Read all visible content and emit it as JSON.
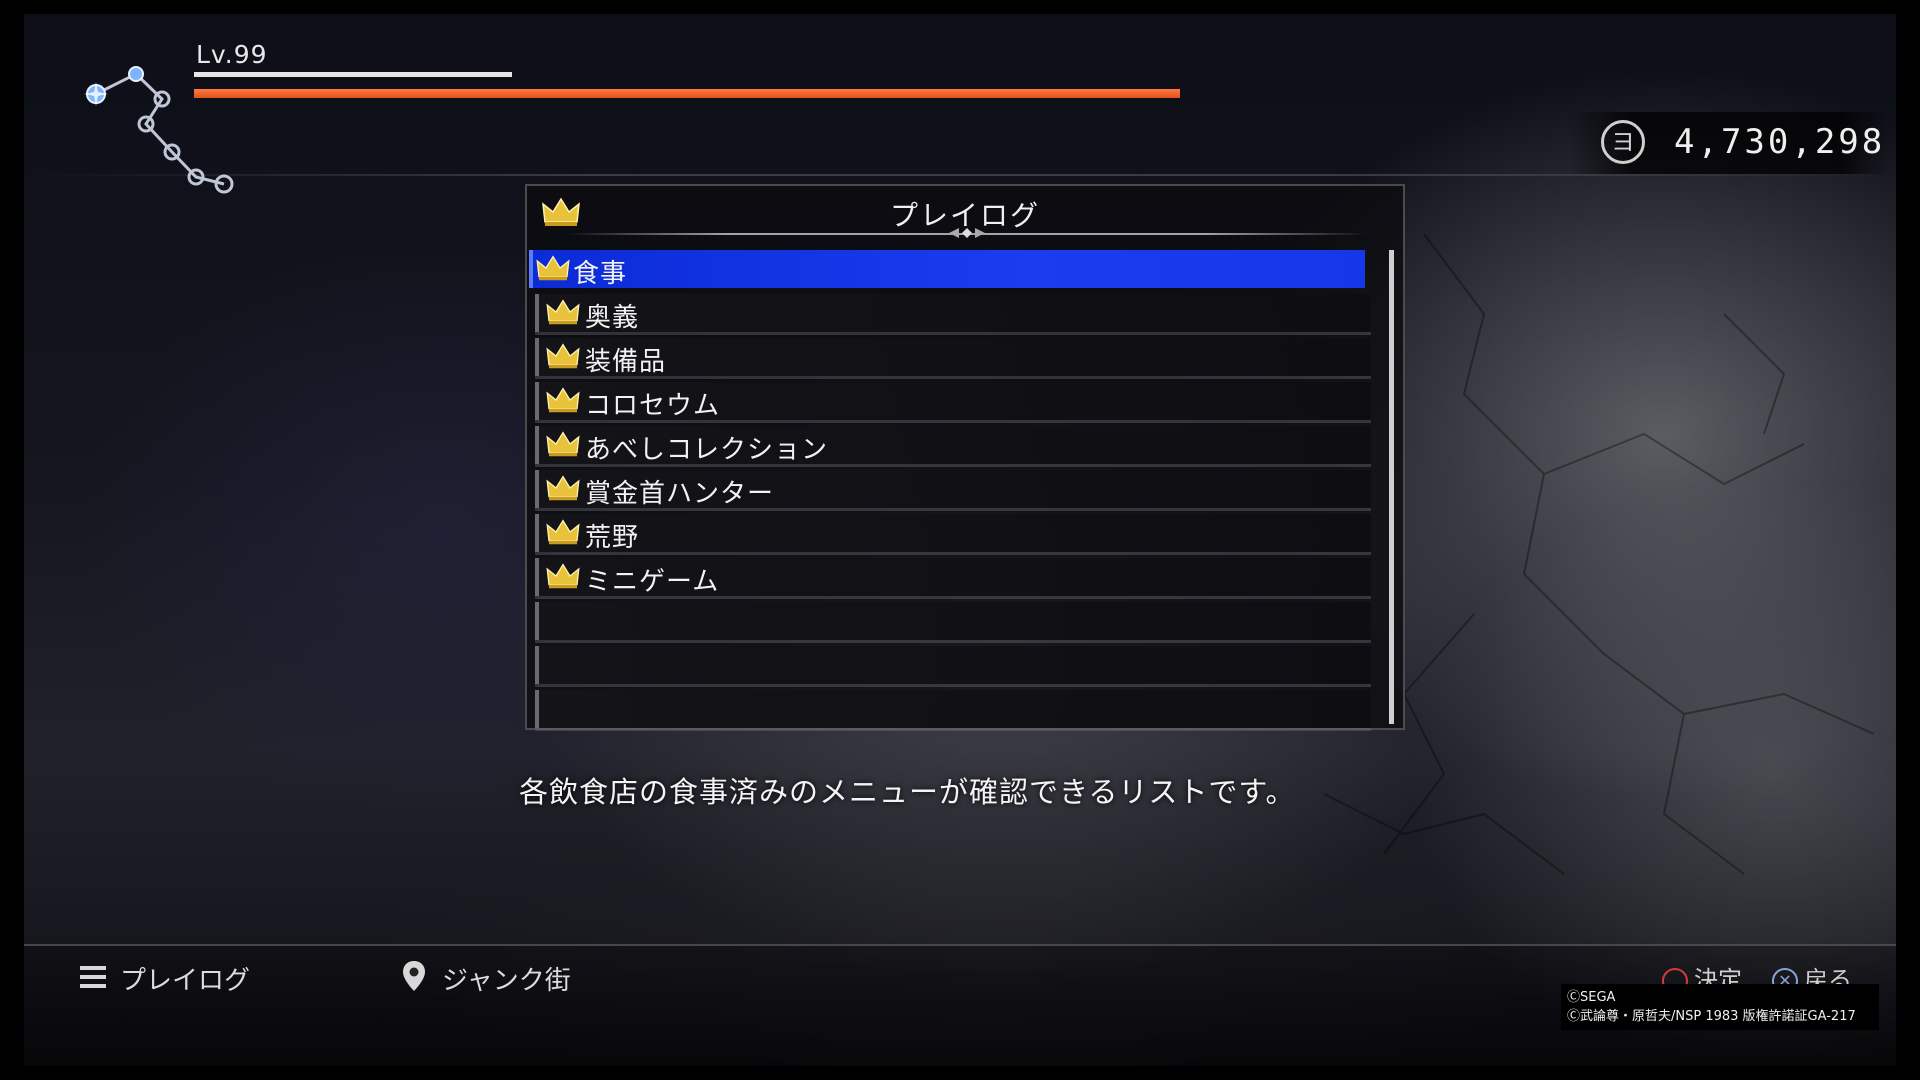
{
  "hud": {
    "level_text": "Lv.99",
    "level_progress": 1.0,
    "hp_fraction": 1.0,
    "money": "4,730,298",
    "money_icon_glyph": "ヨ"
  },
  "panel": {
    "title": "プレイログ",
    "items": [
      {
        "label": "食事",
        "selected": true
      },
      {
        "label": "奥義",
        "selected": false
      },
      {
        "label": "装備品",
        "selected": false
      },
      {
        "label": "コロセウム",
        "selected": false
      },
      {
        "label": "あべしコレクション",
        "selected": false
      },
      {
        "label": "賞金首ハンター",
        "selected": false
      },
      {
        "label": "荒野",
        "selected": false
      },
      {
        "label": "ミニゲーム",
        "selected": false
      },
      {
        "label": "",
        "selected": false
      },
      {
        "label": "",
        "selected": false
      },
      {
        "label": "",
        "selected": false
      }
    ]
  },
  "description": "各飲食店の食事済みのメニューが確認できるリストです。",
  "footer": {
    "menu_label": "プレイログ",
    "location_label": "ジャンク街",
    "confirm_label": "決定",
    "back_label": "戻る"
  },
  "copyright": {
    "line1": "ⒸSEGA",
    "line2": "Ⓒ武論尊・原哲夫/NSP 1983 版権許諾証GA-217"
  },
  "colors": {
    "selected_row": "#1a3df0",
    "hp_bar": "#f26a2e",
    "crown": "#e8c23a"
  }
}
